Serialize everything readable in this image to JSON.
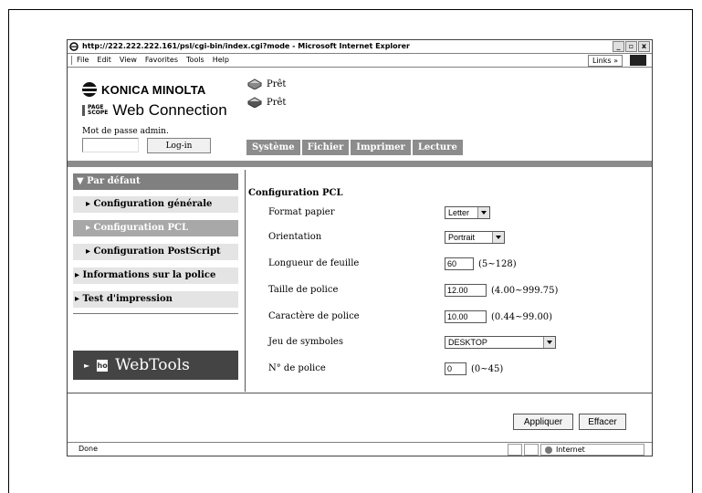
{
  "browser": {
    "title": "http://222.222.222.161/psl/cgi-bin/index.cgi?mode - Microsoft Internet Explorer",
    "menu": [
      "File",
      "Edit",
      "View",
      "Favorites",
      "Tools",
      "Help"
    ],
    "links_label": "Links »",
    "window_buttons": [
      "_",
      "▫",
      "x"
    ],
    "status_text": "Done",
    "zone_text": "Internet"
  },
  "header": {
    "brand": "KONICA MINOLTA",
    "pagescope_badge": [
      "PAGE",
      "SCOPE"
    ],
    "product": "Web Connection",
    "password_label": "Mot de passe admin.",
    "password_value": "",
    "login_label": "Log-in",
    "status": [
      "Prêt",
      "Prêt"
    ]
  },
  "tabs": [
    "Système",
    "Fichier",
    "Imprimer",
    "Lecture"
  ],
  "sidebar": {
    "group": "▼ Par défaut",
    "items": [
      {
        "label": "▸ Configuration générale"
      },
      {
        "label": "▸ Configuration PCL",
        "selected": true
      },
      {
        "label": "▸ Configuration PostScript"
      }
    ],
    "others": [
      "▸ Informations sur la police",
      "▸ Test d'impression"
    ],
    "webtools": "WebTools",
    "webtools_icon": "ho"
  },
  "main": {
    "title": "Configuration PCL",
    "rows": [
      {
        "label": "Format papier",
        "type": "select",
        "value": "Letter",
        "hint": ""
      },
      {
        "label": "Orientation",
        "type": "select",
        "value": "Portrait",
        "hint": ""
      },
      {
        "label": "Longueur de feuille",
        "type": "input",
        "value": "60",
        "hint": "(5~128)"
      },
      {
        "label": "Taille de police",
        "type": "input",
        "value": "12.00",
        "hint": "(4.00~999.75)"
      },
      {
        "label": "Caractère de police",
        "type": "input",
        "value": "10.00",
        "hint": "(0.44~99.00)"
      },
      {
        "label": "Jeu de symboles",
        "type": "select",
        "value": "DESKTOP",
        "hint": ""
      },
      {
        "label": "N° de police",
        "type": "input",
        "value": "0",
        "hint": "(0~45)"
      }
    ],
    "apply_label": "Appliquer",
    "clear_label": "Effacer"
  },
  "colors": {
    "tab_bg": "#8c8c8c",
    "sidebar_dark": "#808080",
    "sidebar_light": "#e4e4e4",
    "webtools_bg": "#444444"
  }
}
